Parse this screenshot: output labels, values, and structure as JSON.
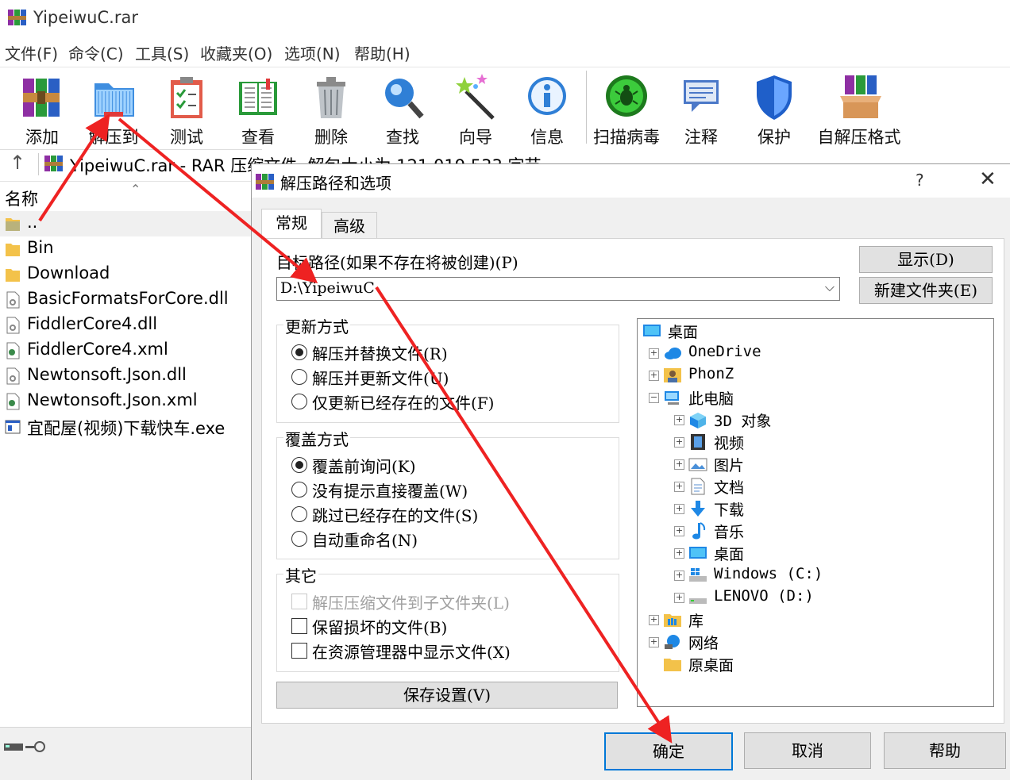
{
  "window": {
    "title": "YipeiwuC.rar"
  },
  "menu": [
    "文件(F)",
    "命令(C)",
    "工具(S)",
    "收藏夹(O)",
    "选项(N)",
    "帮助(H)"
  ],
  "toolbar": [
    {
      "id": "add",
      "label": "添加",
      "icon": "add-archive-icon"
    },
    {
      "id": "extract",
      "label": "解压到",
      "icon": "extract-folder-icon"
    },
    {
      "id": "test",
      "label": "测试",
      "icon": "test-clipboard-icon"
    },
    {
      "id": "view",
      "label": "查看",
      "icon": "view-book-icon"
    },
    {
      "id": "delete",
      "label": "删除",
      "icon": "trash-can-icon"
    },
    {
      "id": "find",
      "label": "查找",
      "icon": "magnifier-icon"
    },
    {
      "id": "wizard",
      "label": "向导",
      "icon": "magic-wand-icon"
    },
    {
      "id": "info",
      "label": "信息",
      "icon": "info-icon"
    },
    {
      "id": "scan",
      "label": "扫描病毒",
      "icon": "virus-scan-icon"
    },
    {
      "id": "comment",
      "label": "注释",
      "icon": "comment-icon"
    },
    {
      "id": "protect",
      "label": "保护",
      "icon": "shield-icon"
    },
    {
      "id": "sfx",
      "label": "自解压格式",
      "icon": "sfx-box-icon"
    }
  ],
  "pathbar": {
    "text": "YipeiwuC.rar - RAR 压缩文件, 解包大小为 121,019,533 字节"
  },
  "filelist": {
    "column_name": "名称",
    "files": [
      {
        "name": "..",
        "icon": "parent-folder-icon"
      },
      {
        "name": "Bin",
        "icon": "folder-icon"
      },
      {
        "name": "Download",
        "icon": "folder-icon"
      },
      {
        "name": "BasicFormatsForCore.dll",
        "icon": "dll-file-icon"
      },
      {
        "name": "FiddlerCore4.dll",
        "icon": "dll-file-icon"
      },
      {
        "name": "FiddlerCore4.xml",
        "icon": "xml-file-icon"
      },
      {
        "name": "Newtonsoft.Json.dll",
        "icon": "dll-file-icon"
      },
      {
        "name": "Newtonsoft.Json.xml",
        "icon": "xml-file-icon"
      },
      {
        "name": "宜配屋(视频)下载快车.exe",
        "icon": "exe-file-icon"
      }
    ]
  },
  "dialog": {
    "title": "解压路径和选项",
    "help_glyph": "?",
    "close_glyph": "✕",
    "tabs": [
      "常规",
      "高级"
    ],
    "dest_label": "目标路径(如果不存在将被创建)(P)",
    "dest_value": "D:\\YipeiwuC",
    "show_button": "显示(D)",
    "new_folder_button": "新建文件夹(E)",
    "update_group": {
      "title": "更新方式",
      "options": [
        {
          "label": "解压并替换文件(R)",
          "checked": true
        },
        {
          "label": "解压并更新文件(U)",
          "checked": false
        },
        {
          "label": "仅更新已经存在的文件(F)",
          "checked": false
        }
      ]
    },
    "overwrite_group": {
      "title": "覆盖方式",
      "options": [
        {
          "label": "覆盖前询问(K)",
          "checked": true
        },
        {
          "label": "没有提示直接覆盖(W)",
          "checked": false
        },
        {
          "label": "跳过已经存在的文件(S)",
          "checked": false
        },
        {
          "label": "自动重命名(N)",
          "checked": false
        }
      ]
    },
    "misc_group": {
      "title": "其它",
      "options": [
        {
          "label": "解压压缩文件到子文件夹(L)",
          "checked": false,
          "disabled": true
        },
        {
          "label": "保留损坏的文件(B)",
          "checked": false,
          "disabled": false
        },
        {
          "label": "在资源管理器中显示文件(X)",
          "checked": false,
          "disabled": false
        }
      ]
    },
    "save_button": "保存设置(V)",
    "tree": [
      {
        "label": "桌面",
        "level": 0,
        "icon": "desktop-icon",
        "expander": ""
      },
      {
        "label": "OneDrive",
        "level": 1,
        "icon": "cloud-icon",
        "expander": "+"
      },
      {
        "label": "PhonZ",
        "level": 1,
        "icon": "user-icon",
        "expander": "+"
      },
      {
        "label": "此电脑",
        "level": 1,
        "icon": "computer-icon",
        "expander": "−"
      },
      {
        "label": "3D 对象",
        "level": 2,
        "icon": "cube-3d-icon",
        "expander": "+"
      },
      {
        "label": "视频",
        "level": 2,
        "icon": "film-icon",
        "expander": "+"
      },
      {
        "label": "图片",
        "level": 2,
        "icon": "picture-icon",
        "expander": "+"
      },
      {
        "label": "文档",
        "level": 2,
        "icon": "document-icon",
        "expander": "+"
      },
      {
        "label": "下载",
        "level": 2,
        "icon": "download-arrow-icon",
        "expander": "+"
      },
      {
        "label": "音乐",
        "level": 2,
        "icon": "music-note-icon",
        "expander": "+"
      },
      {
        "label": "桌面",
        "level": 2,
        "icon": "desktop-icon",
        "expander": "+"
      },
      {
        "label": "Windows (C:)",
        "level": 2,
        "icon": "windows-drive-icon",
        "expander": "+"
      },
      {
        "label": "LENOVO (D:)",
        "level": 2,
        "icon": "drive-icon",
        "expander": "+"
      },
      {
        "label": "库",
        "level": 1,
        "icon": "library-icon",
        "expander": "+"
      },
      {
        "label": "网络",
        "level": 1,
        "icon": "network-icon",
        "expander": "+"
      },
      {
        "label": "原桌面",
        "level": 1,
        "icon": "folder-icon",
        "expander": ""
      }
    ],
    "ok_button": "确定",
    "cancel_button": "取消",
    "help_button": "帮助"
  },
  "colors": {
    "arrow": "#ee2222",
    "accent": "#0078d7",
    "folder": "#f3c24a"
  }
}
